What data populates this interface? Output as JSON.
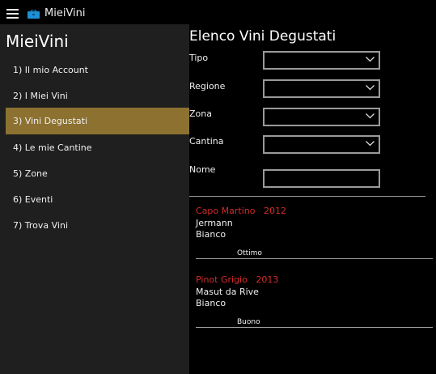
{
  "app": {
    "title": "MieiVini"
  },
  "sidebar": {
    "title": "MieiVini",
    "items": [
      {
        "label": "1) Il mio Account",
        "active": false
      },
      {
        "label": "2) I Miei Vini",
        "active": false
      },
      {
        "label": "3) Vini Degustati",
        "active": true
      },
      {
        "label": "4) Le mie Cantine",
        "active": false
      },
      {
        "label": "5) Zone",
        "active": false
      },
      {
        "label": "6) Eventi",
        "active": false
      },
      {
        "label": "7) Trova Vini",
        "active": false
      }
    ]
  },
  "main": {
    "title": "Elenco Vini Degustati",
    "filters": {
      "tipo": {
        "label": "Tipo",
        "value": ""
      },
      "regione": {
        "label": "Regione",
        "value": ""
      },
      "zona": {
        "label": "Zona",
        "value": ""
      },
      "cantina": {
        "label": "Cantina",
        "value": ""
      },
      "nome": {
        "label": "Nome",
        "value": ""
      }
    },
    "wines": [
      {
        "name": "Capo Martino   2012",
        "producer": "Jermann",
        "type": "Bianco",
        "rating": "Ottimo"
      },
      {
        "name": "Pinot Grigio   2013",
        "producer": "Masut da Rive",
        "type": "Bianco",
        "rating": "Buono"
      }
    ]
  },
  "colors": {
    "accent": "#8c7131",
    "wine_name": "#d42b2b",
    "sidebar_bg": "#1f1f1f"
  }
}
